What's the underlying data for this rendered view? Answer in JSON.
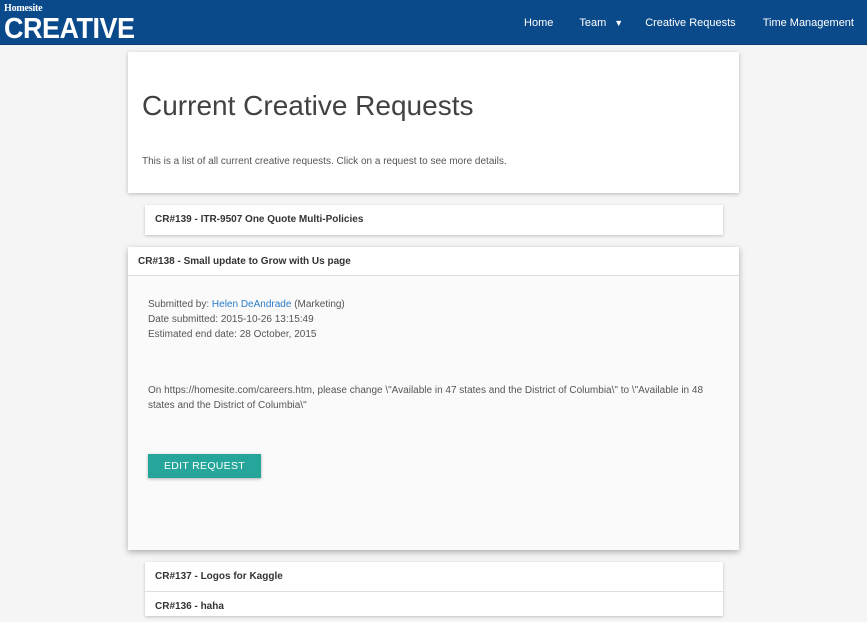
{
  "brand": {
    "small": "Homesite",
    "big": "CREATIVE"
  },
  "nav": {
    "home": "Home",
    "team": "Team",
    "team_caret": "▼",
    "creative_requests": "Creative Requests",
    "time_management": "Time Management"
  },
  "header": {
    "title": "Current Creative Requests",
    "description": "This is a list of all current creative requests. Click on a request to see more details."
  },
  "requests": [
    {
      "title": "CR#139 - ITR-9507 One Quote Multi-Policies"
    },
    {
      "title": "CR#138 - Small update to Grow with Us page",
      "submitted_prefix": "Submitted by: ",
      "submitter": "Helen DeAndrade",
      "department": " (Marketing)",
      "date_submitted": "Date submitted: 2015-10-26 13:15:49",
      "end_date": "Estimated end date: 28 October, 2015",
      "body": "On https://homesite.com/careers.htm, please change \\\"Available in 47 states and the District of Columbia\\\" to \\\"Available in 48 states and the District of Columbia\\\"",
      "edit_label": "EDIT REQUEST"
    },
    {
      "title": "CR#137 - Logos for Kaggle"
    },
    {
      "title": "CR#136 - haha"
    }
  ],
  "colors": {
    "navbar": "#0a4a8a",
    "accent": "#26a69a",
    "link": "#2a7cc7"
  }
}
